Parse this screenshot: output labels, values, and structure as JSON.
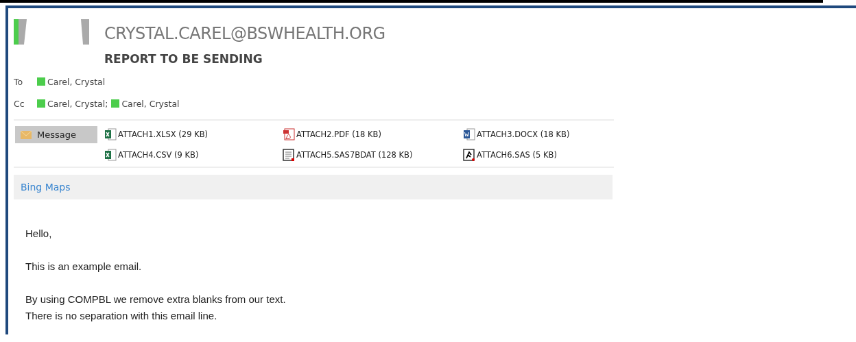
{
  "sender": {
    "address": "CRYSTAL.CAREL@BSWHEALTH.ORG"
  },
  "subject": "REPORT TO BE SENDING",
  "recipients": [
    {
      "label": "To",
      "names": [
        "Carel, Crystal"
      ]
    },
    {
      "label": "Cc",
      "names": [
        "Carel, Crystal;",
        "Carel, Crystal"
      ]
    }
  ],
  "message_tab": {
    "label": "Message",
    "selected": true
  },
  "attachments": [
    {
      "kind": "xlsx",
      "name": "ATTACH1.XLSX (29 KB)"
    },
    {
      "kind": "pdf",
      "name": "ATTACH2.PDF (18 KB)"
    },
    {
      "kind": "docx",
      "name": "ATTACH3.DOCX (18 KB)"
    },
    {
      "kind": "csv",
      "name": "ATTACH4.CSV (9 KB)"
    },
    {
      "kind": "sas7bdat",
      "name": "ATTACH5.SAS7BDAT (128 KB)"
    },
    {
      "kind": "sas",
      "name": "ATTACH6.SAS (5 KB)"
    }
  ],
  "addin_bar": {
    "link": "Bing Maps"
  },
  "body": {
    "paragraphs": [
      [
        "Hello,"
      ],
      [
        "This is an example email."
      ],
      [
        "By using COMPBL we remove extra blanks from our text.",
        "There is no separation with this email line."
      ]
    ]
  }
}
